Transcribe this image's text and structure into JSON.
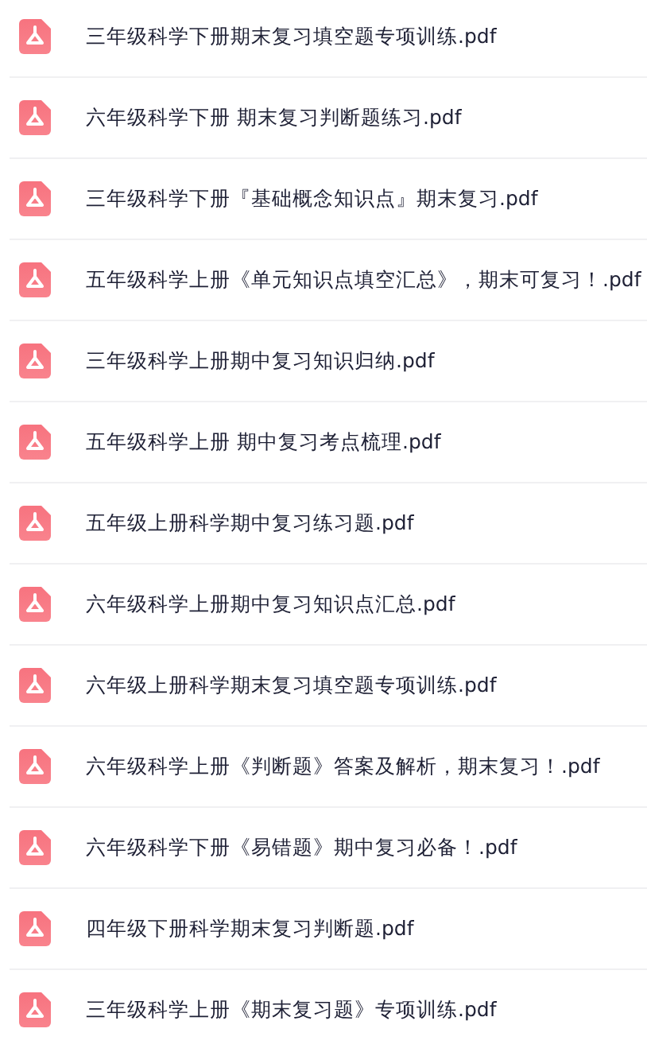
{
  "files": [
    {
      "name": "三年级科学下册期末复习填空题专项训练.pdf"
    },
    {
      "name": "六年级科学下册 期末复习判断题练习.pdf"
    },
    {
      "name": "三年级科学下册『基础概念知识点』期末复习.pdf"
    },
    {
      "name": "五年级科学上册《单元知识点填空汇总》，期末可复习！.pdf"
    },
    {
      "name": "三年级科学上册期中复习知识归纳.pdf"
    },
    {
      "name": "五年级科学上册 期中复习考点梳理.pdf"
    },
    {
      "name": "五年级上册科学期中复习练习题.pdf"
    },
    {
      "name": "六年级科学上册期中复习知识点汇总.pdf"
    },
    {
      "name": "六年级上册科学期末复习填空题专项训练.pdf"
    },
    {
      "name": "六年级科学上册《判断题》答案及解析，期末复习！.pdf"
    },
    {
      "name": "六年级科学下册《易错题》期中复习必备！.pdf"
    },
    {
      "name": "四年级下册科学期末复习判断题.pdf"
    },
    {
      "name": "三年级科学上册《期末复习题》专项训练.pdf"
    }
  ]
}
